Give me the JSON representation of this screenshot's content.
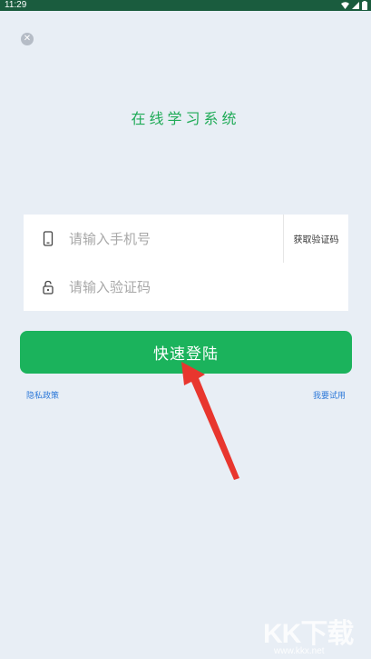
{
  "status_bar": {
    "time": "11:29"
  },
  "close": {
    "icon": "close-icon",
    "glyph": "✕"
  },
  "app": {
    "title": "在线学习系统"
  },
  "form": {
    "phone": {
      "placeholder": "请输入手机号",
      "value": "",
      "icon": "phone-icon"
    },
    "code": {
      "placeholder": "请输入验证码",
      "value": "",
      "icon": "lock-icon"
    },
    "get_code_label": "获取验证码"
  },
  "login_button": {
    "label": "快速登陆"
  },
  "links": {
    "privacy": "隐私政策",
    "trial": "我要试用"
  },
  "watermark": {
    "logo": "KK下载",
    "url": "www.kkx.net"
  },
  "colors": {
    "accent": "#1bb35c",
    "status_bar": "#1a5c3e",
    "link": "#2f7ad9",
    "annotation_arrow": "#e8362e"
  }
}
